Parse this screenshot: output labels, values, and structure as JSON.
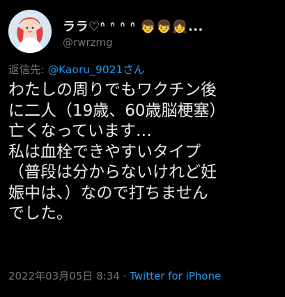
{
  "author": {
    "display_name": "ララ♡ᐢ ᐢ ᐢ ᐢ 👦👦👧...",
    "handle": "@rwrzmg",
    "avatar_icon": "avatar-icon"
  },
  "reply": {
    "prefix": "返信先: ",
    "mention": "@Kaoru_9021さん"
  },
  "tweet": {
    "text": "わたしの周りでもワクチン後\nに二人（19歳、60歳脳梗塞）\n亡くなっています…\n私は血栓できやすいタイプ\n（普段は分からないけれど妊\n娠中は、）なので打ちません\nでした。",
    "timestamp": "2022年03月05日 8:34 · ",
    "source": "Twitter for iPhone"
  },
  "colors": {
    "background": "#000000",
    "text": "#e7e9ea",
    "muted": "#71767b",
    "link": "#1d9bf0"
  }
}
